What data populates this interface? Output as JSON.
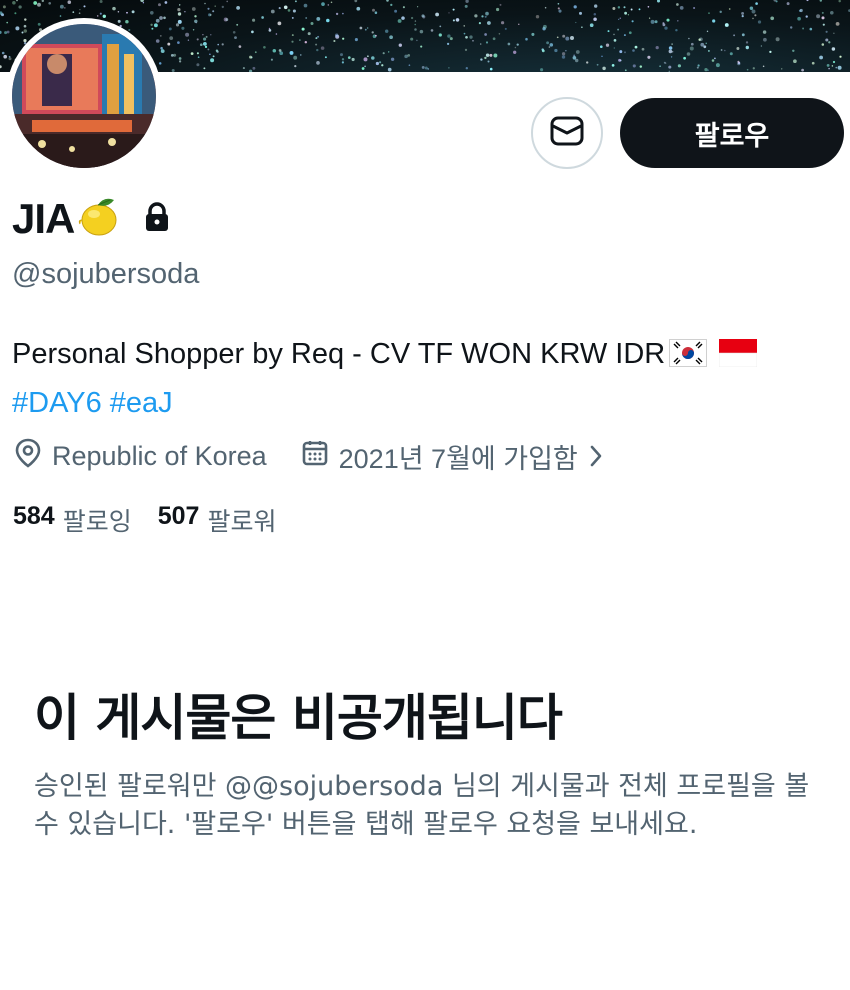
{
  "profile": {
    "display_name": "JIA",
    "handle": "@sojubersoda",
    "bio": "Personal Shopper by Req - CV TF WON KRW IDR",
    "hashtags": "#DAY6 #eaJ",
    "location": "Republic of Korea",
    "joined": "2021년 7월에 가입함",
    "following_count": "584",
    "following_label": "팔로잉",
    "followers_count": "507",
    "followers_label": "팔로워"
  },
  "actions": {
    "follow_label": "팔로우"
  },
  "private_notice": {
    "title": "이 게시물은 비공개됩니다",
    "body": "승인된 팔로워만 @@sojubersoda 님의 게시물과 전체 프로필을 볼 수 있습니다. '팔로우' 버튼을 탭해 팔로우 요청을 보내세요."
  },
  "icons": {
    "message": "envelope-icon",
    "location": "map-pin-icon",
    "calendar": "calendar-icon",
    "lock": "lock-icon",
    "lemon": "lemon-emoji",
    "flags": [
      "south-korea-flag",
      "indonesia-flag"
    ]
  },
  "colors": {
    "text": "#0f1419",
    "secondary_text": "#536471",
    "link": "#1d9bf0",
    "button_dark": "#0f1419",
    "border": "#cfd9de"
  }
}
